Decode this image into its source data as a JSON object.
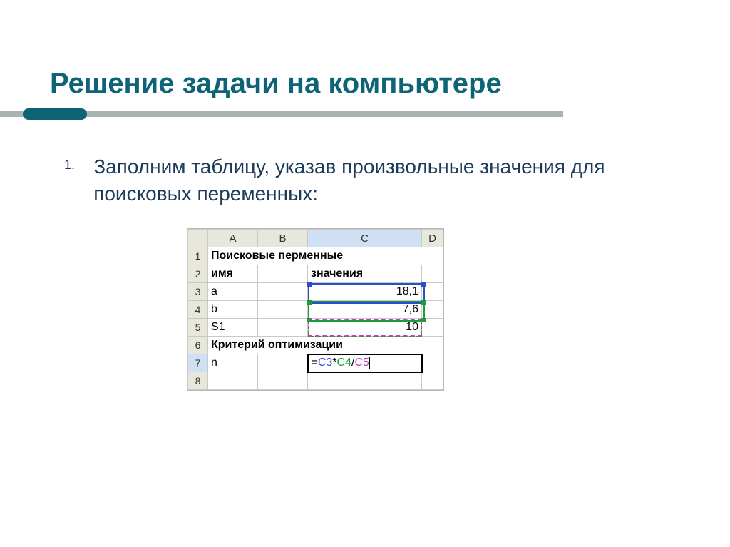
{
  "title": "Решение задачи на компьютере",
  "list": {
    "num1": "1.",
    "text1": "Заполним таблицу, указав произвольные значения для поисковых переменных:"
  },
  "sheet": {
    "cols": {
      "a": "A",
      "b": "B",
      "c": "C",
      "d": "D"
    },
    "rows": {
      "r1": "1",
      "r2": "2",
      "r3": "3",
      "r4": "4",
      "r5": "5",
      "r6": "6",
      "r7": "7",
      "r8": "8"
    },
    "cells": {
      "a1": "Поисковые перменные",
      "a2": "имя",
      "c2": "значения",
      "a3": "a",
      "c3": "18,1",
      "a4": "b",
      "c4": "7,6",
      "a5": "S1",
      "c5": "10",
      "a6": "Критерий оптимизации",
      "a7": "n",
      "c7_prefix": "=",
      "c7_ref1": "C3",
      "c7_op1": "*",
      "c7_ref2": "C4",
      "c7_op2": "/",
      "c7_ref3": "C5"
    }
  }
}
